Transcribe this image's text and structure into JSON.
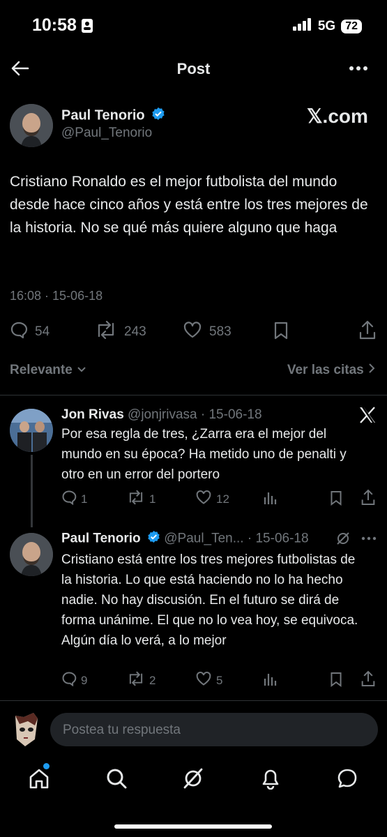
{
  "status_bar": {
    "time": "10:58",
    "network": "5G",
    "battery": "72"
  },
  "header": {
    "title": "Post"
  },
  "post": {
    "author_name": "Paul Tenorio",
    "author_handle": "@Paul_Tenorio",
    "watermark": "𝕏.com",
    "text": "Cristiano Ronaldo es el mejor futbolista del mundo desde hace cinco años y está entre los tres mejores de la historia. No se qué más quiere alguno que haga",
    "timestamp": "16:08 · 15-06-18",
    "replies": "54",
    "reposts": "243",
    "likes": "583"
  },
  "sort": {
    "label": "Relevante",
    "quotes_label": "Ver las citas"
  },
  "replies": [
    {
      "author_name": "Jon Rivas",
      "author_handle": "@jonjrivasa",
      "date": "· 15-06-18",
      "text": "Por esa regla de tres, ¿Zarra era el mejor del mundo en su época? Ha metido uno de penalti y otro en un error del portero",
      "replies": "1",
      "reposts": "1",
      "likes": "12"
    },
    {
      "author_name": "Paul Tenorio",
      "author_handle": "@Paul_Ten...",
      "date": "· 15-06-18",
      "text": "Cristiano está entre los tres mejores futbolistas de la historia. Lo que está haciendo no lo ha hecho nadie. No hay discusión. En el futuro se dirá de forma unánime. El que no lo vea hoy, se equivoca. Algún día lo verá, a lo mejor",
      "replies": "9",
      "reposts": "2",
      "likes": "5"
    }
  ],
  "composer": {
    "placeholder": "Postea tu respuesta"
  },
  "colors": {
    "accent": "#1d9bf0",
    "muted": "#71767b",
    "text": "#e7e9ea",
    "background": "#000000"
  }
}
